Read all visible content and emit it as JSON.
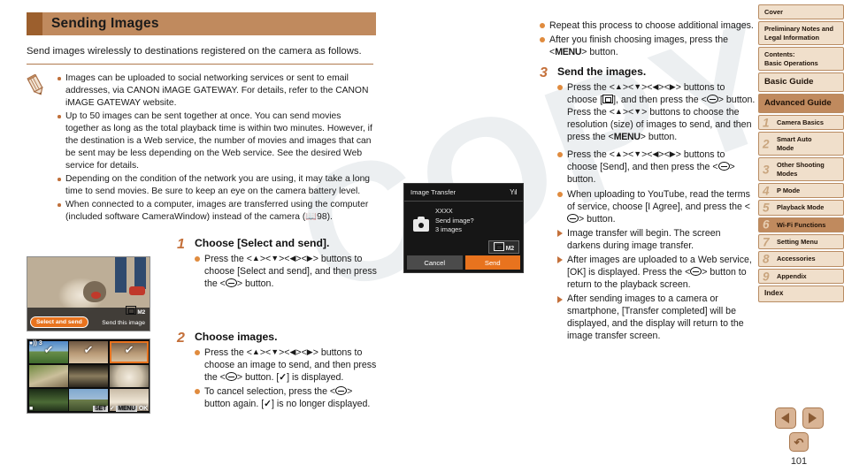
{
  "header": {
    "title": "Sending Images"
  },
  "lead": "Send images wirelessly to destinations registered on the camera as follows.",
  "notes": [
    "Images can be uploaded to social networking services or sent to email addresses, via CANON iMAGE GATEWAY. For details, refer to the CANON iMAGE GATEWAY website.",
    "Up to 50 images can be sent together at once. You can send movies together as long as the total playback time is within two minutes. However, if the destination is a Web service, the number of movies and images that can be sent may be less depending on the Web service. See the desired Web service for details.",
    "Depending on the condition of the network you are using, it may take a long time to send movies. Be sure to keep an eye on the camera battery level.",
    "When connected to a computer, images are transferred using the computer (included software CameraWindow) instead of the camera ( 98)."
  ],
  "steps": [
    {
      "num": "1",
      "head": "Choose [Select and send].",
      "bullets": [
        {
          "kind": "dot",
          "text": "Press the <▲><▼><◀><▶> buttons to choose [Select and send], and then press the <FUNC.SET> button."
        }
      ]
    },
    {
      "num": "2",
      "head": "Choose images.",
      "bullets": [
        {
          "kind": "dot",
          "text": "Press the <▲><▼><◀><▶> buttons to choose an image to send, and then press the <FUNC.SET> button. [✓] is displayed."
        },
        {
          "kind": "dot",
          "text": "To cancel selection, press the <FUNC.SET> button again. [✓] is no longer displayed."
        }
      ]
    },
    {
      "num": "3",
      "head": "Send the images.",
      "bullets": [
        {
          "kind": "dot",
          "text": "Press the <▲><▼><◀><▶> buttons to choose [resize], and then press the <FUNC.SET> button. Press the <▲><▼> buttons to choose the resolution (size) of images to send, and then press the <MENU> button."
        },
        {
          "kind": "dot",
          "text": "Press the <▲><▼><◀><▶> buttons to choose [Send], and then press the <FUNC.SET> button."
        },
        {
          "kind": "dot",
          "text": "When uploading to YouTube, read the terms of service, choose [I Agree], and press the <FUNC.SET> button."
        },
        {
          "kind": "tri",
          "text": "Image transfer will begin. The screen darkens during image transfer."
        },
        {
          "kind": "tri",
          "text": "After images are uploaded to a Web service, [OK] is displayed. Press the <FUNC.SET> button to return to the playback screen."
        },
        {
          "kind": "tri",
          "text": "After sending images to a camera or smartphone, [Transfer completed] will be displayed, and the display will return to the image transfer screen."
        }
      ]
    }
  ],
  "right_column_bullets": [
    {
      "kind": "dot",
      "text": "Repeat this process to choose additional images."
    },
    {
      "kind": "dot",
      "text": "After you finish choosing images, press the <MENU> button."
    }
  ],
  "screenshots": {
    "shot1": {
      "select_and_send_label": "Select and send",
      "send_this_image_label": "Send this image",
      "resolution_badge": "M2"
    },
    "shot2": {
      "count": "3",
      "set_hint": "SET",
      "menu_hint": "MENU",
      "ok_hint": "OK"
    },
    "camera_dialog": {
      "title": "Image Transfer",
      "signal": "Yıl",
      "recipient": "XXXX",
      "question": "Send image?",
      "count_text": "3 images",
      "resolution_badge": "M2",
      "cancel_label": "Cancel",
      "send_label": "Send"
    }
  },
  "nav": {
    "items": [
      {
        "label": "Cover",
        "style": "plain"
      },
      {
        "label": "Preliminary Notes and Legal Information",
        "style": "tall"
      },
      {
        "label": "Contents:\nBasic Operations",
        "style": "tall"
      },
      {
        "label": "Basic Guide",
        "style": "big"
      },
      {
        "label": "Advanced Guide",
        "style": "section"
      },
      {
        "label": "Camera Basics",
        "num": "1",
        "style": "numbered"
      },
      {
        "label": "Smart Auto Mode",
        "num": "2",
        "style": "numbered-tall"
      },
      {
        "label": "Other Shooting Modes",
        "num": "3",
        "style": "numbered-tall"
      },
      {
        "label": "P Mode",
        "num": "4",
        "style": "numbered"
      },
      {
        "label": "Playback Mode",
        "num": "5",
        "style": "numbered"
      },
      {
        "label": "Wi-Fi Functions",
        "num": "6",
        "style": "numbered-current"
      },
      {
        "label": "Setting Menu",
        "num": "7",
        "style": "numbered"
      },
      {
        "label": "Accessories",
        "num": "8",
        "style": "numbered"
      },
      {
        "label": "Appendix",
        "num": "9",
        "style": "numbered"
      },
      {
        "label": "Index",
        "style": "index"
      }
    ]
  },
  "footer": {
    "prev_icon": "left-arrow-icon",
    "next_icon": "right-arrow-icon",
    "return_icon": "return-icon",
    "page_number": "101"
  },
  "watermark": "COPY",
  "colors": {
    "accent_header": "#c08a5e",
    "accent_tab": "#9c5f2d",
    "orange_bullet": "#e08b3e",
    "brown_text": "#c4703a",
    "nav_bg": "#f0dfcb",
    "nav_border": "#b98c63"
  }
}
